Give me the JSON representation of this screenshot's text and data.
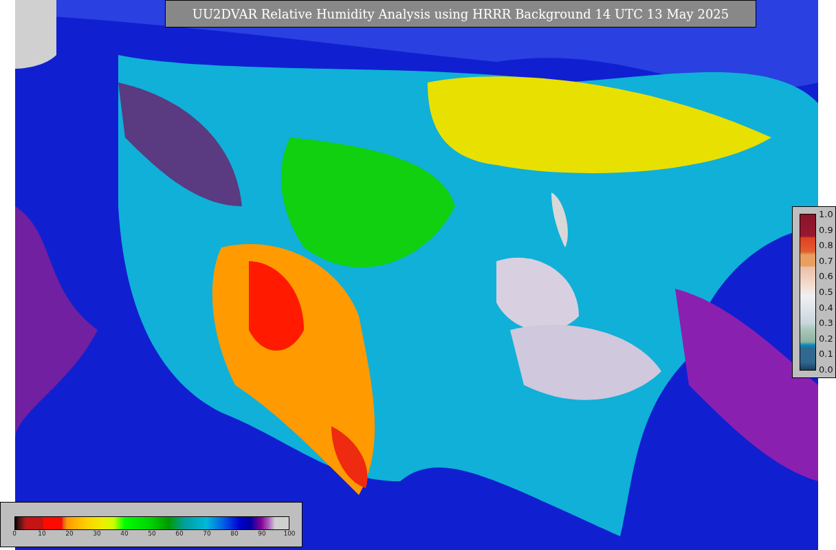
{
  "title": "UU2DVAR Relative Humidity Analysis using HRRR Background 14 UTC 13 May 2025",
  "humidity_scale": {
    "ticks": [
      "0",
      "10",
      "20",
      "30",
      "40",
      "50",
      "60",
      "70",
      "80",
      "90",
      "100"
    ]
  },
  "side_scale": {
    "ticks": [
      "1.0",
      "0.9",
      "0.8",
      "0.7",
      "0.6",
      "0.5",
      "0.4",
      "0.3",
      "0.2",
      "0.1",
      "0.0"
    ]
  }
}
